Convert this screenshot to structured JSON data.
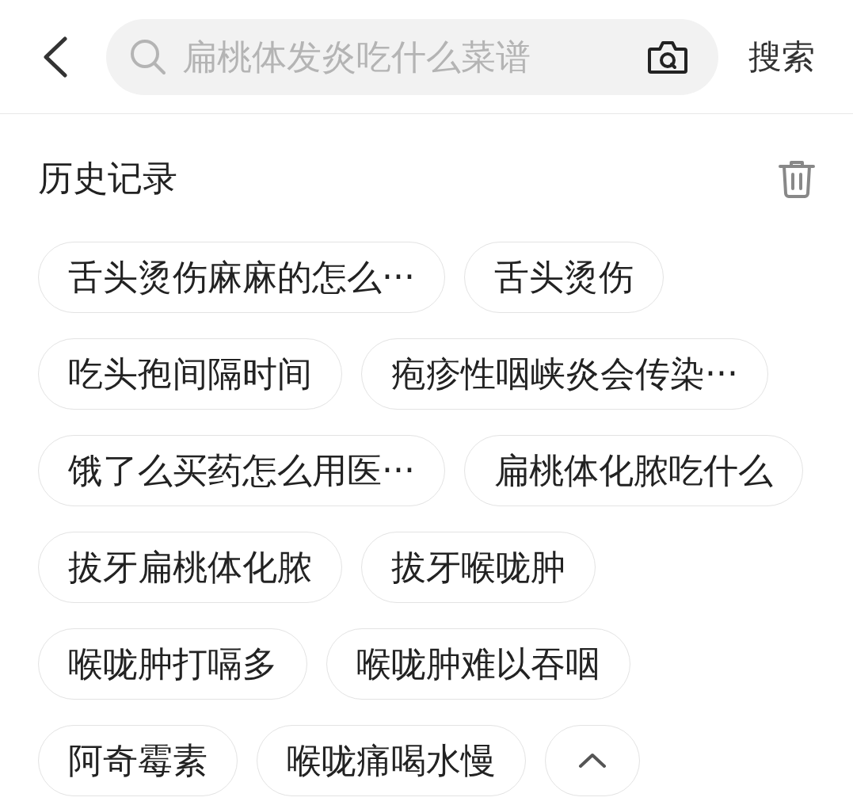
{
  "search": {
    "placeholder": "扁桃体发炎吃什么菜谱",
    "button": "搜索"
  },
  "history": {
    "title": "历史记录",
    "expanded": true,
    "items": [
      "舌头烫伤麻麻的怎么···",
      "舌头烫伤",
      "吃头孢间隔时间",
      "疱疹性咽峡炎会传染···",
      "饿了么买药怎么用医···",
      "扁桃体化脓吃什么",
      "拔牙扁桃体化脓",
      "拔牙喉咙肿",
      "喉咙肿打嗝多",
      "喉咙肿难以吞咽",
      "阿奇霉素",
      "喉咙痛喝水慢"
    ]
  }
}
